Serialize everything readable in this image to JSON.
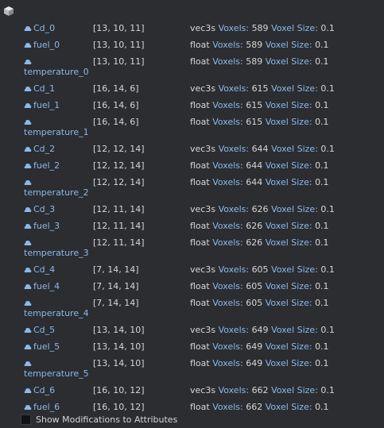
{
  "header": {
    "icon": "cube-icon"
  },
  "labels": {
    "voxels": "Voxels:",
    "voxel_size": "Voxel Size:"
  },
  "grids": [
    {
      "name": "Cd_0",
      "dims": "[13, 10, 11]",
      "type": "vec3s",
      "voxels": "589",
      "voxel_size": "0.1"
    },
    {
      "name": "fuel_0",
      "dims": "[13, 10, 11]",
      "type": "float",
      "voxels": "589",
      "voxel_size": "0.1"
    },
    {
      "name": "temperature_0",
      "dims": "[13, 10, 11]",
      "type": "float",
      "voxels": "589",
      "voxel_size": "0.1"
    },
    {
      "name": "Cd_1",
      "dims": "[16, 14, 6]",
      "type": "vec3s",
      "voxels": "615",
      "voxel_size": "0.1"
    },
    {
      "name": "fuel_1",
      "dims": "[16, 14, 6]",
      "type": "float",
      "voxels": "615",
      "voxel_size": "0.1"
    },
    {
      "name": "temperature_1",
      "dims": "[16, 14, 6]",
      "type": "float",
      "voxels": "615",
      "voxel_size": "0.1"
    },
    {
      "name": "Cd_2",
      "dims": "[12, 12, 14]",
      "type": "vec3s",
      "voxels": "644",
      "voxel_size": "0.1"
    },
    {
      "name": "fuel_2",
      "dims": "[12, 12, 14]",
      "type": "float",
      "voxels": "644",
      "voxel_size": "0.1"
    },
    {
      "name": "temperature_2",
      "dims": "[12, 12, 14]",
      "type": "float",
      "voxels": "644",
      "voxel_size": "0.1"
    },
    {
      "name": "Cd_3",
      "dims": "[12, 11, 14]",
      "type": "vec3s",
      "voxels": "626",
      "voxel_size": "0.1"
    },
    {
      "name": "fuel_3",
      "dims": "[12, 11, 14]",
      "type": "float",
      "voxels": "626",
      "voxel_size": "0.1"
    },
    {
      "name": "temperature_3",
      "dims": "[12, 11, 14]",
      "type": "float",
      "voxels": "626",
      "voxel_size": "0.1"
    },
    {
      "name": "Cd_4",
      "dims": "[7, 14, 14]",
      "type": "vec3s",
      "voxels": "605",
      "voxel_size": "0.1"
    },
    {
      "name": "fuel_4",
      "dims": "[7, 14, 14]",
      "type": "float",
      "voxels": "605",
      "voxel_size": "0.1"
    },
    {
      "name": "temperature_4",
      "dims": "[7, 14, 14]",
      "type": "float",
      "voxels": "605",
      "voxel_size": "0.1"
    },
    {
      "name": "Cd_5",
      "dims": "[13, 14, 10]",
      "type": "vec3s",
      "voxels": "649",
      "voxel_size": "0.1"
    },
    {
      "name": "fuel_5",
      "dims": "[13, 14, 10]",
      "type": "float",
      "voxels": "649",
      "voxel_size": "0.1"
    },
    {
      "name": "temperature_5",
      "dims": "[13, 14, 10]",
      "type": "float",
      "voxels": "649",
      "voxel_size": "0.1"
    },
    {
      "name": "Cd_6",
      "dims": "[16, 10, 12]",
      "type": "vec3s",
      "voxels": "662",
      "voxel_size": "0.1"
    },
    {
      "name": "fuel_6",
      "dims": "[16, 10, 12]",
      "type": "float",
      "voxels": "662",
      "voxel_size": "0.1"
    }
  ],
  "footer": {
    "checkbox_checked": false,
    "label": "Show Modifications to Attributes"
  },
  "colors": {
    "background": "#2b2d31",
    "name": "#8db8e8",
    "text": "#d6d6d6"
  }
}
